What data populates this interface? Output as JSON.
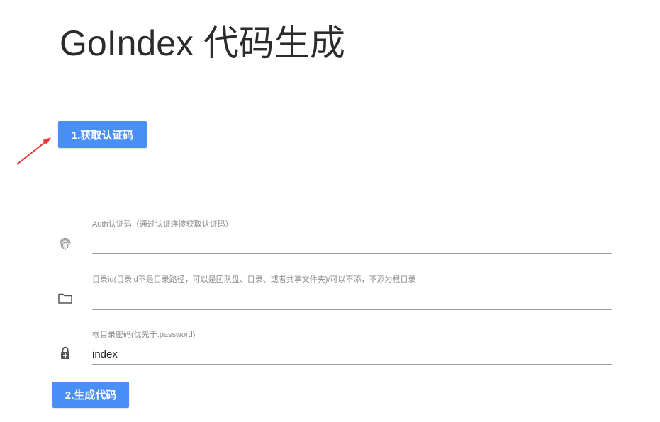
{
  "header": {
    "title": "GoIndex 代码生成"
  },
  "buttons": {
    "auth_label": "1.获取认证码",
    "generate_label": "2.生成代码",
    "accent_color": "#4a8ff7"
  },
  "annotation": {
    "arrow_color": "#e53935"
  },
  "form": {
    "auth": {
      "label": "Auth认证码（通过认证连接获取认证码）",
      "value": "",
      "icon": "fingerprint-icon"
    },
    "folder_id": {
      "label": "目录id(目录id不是目录路径，可以是团队盘、目录、或者共享文件夹)/可以不添，不添为根目录",
      "value": "",
      "icon": "folder-icon"
    },
    "root_password": {
      "label": "根目录密码(优先于.password)",
      "value": "index",
      "icon": "lock-icon"
    }
  }
}
